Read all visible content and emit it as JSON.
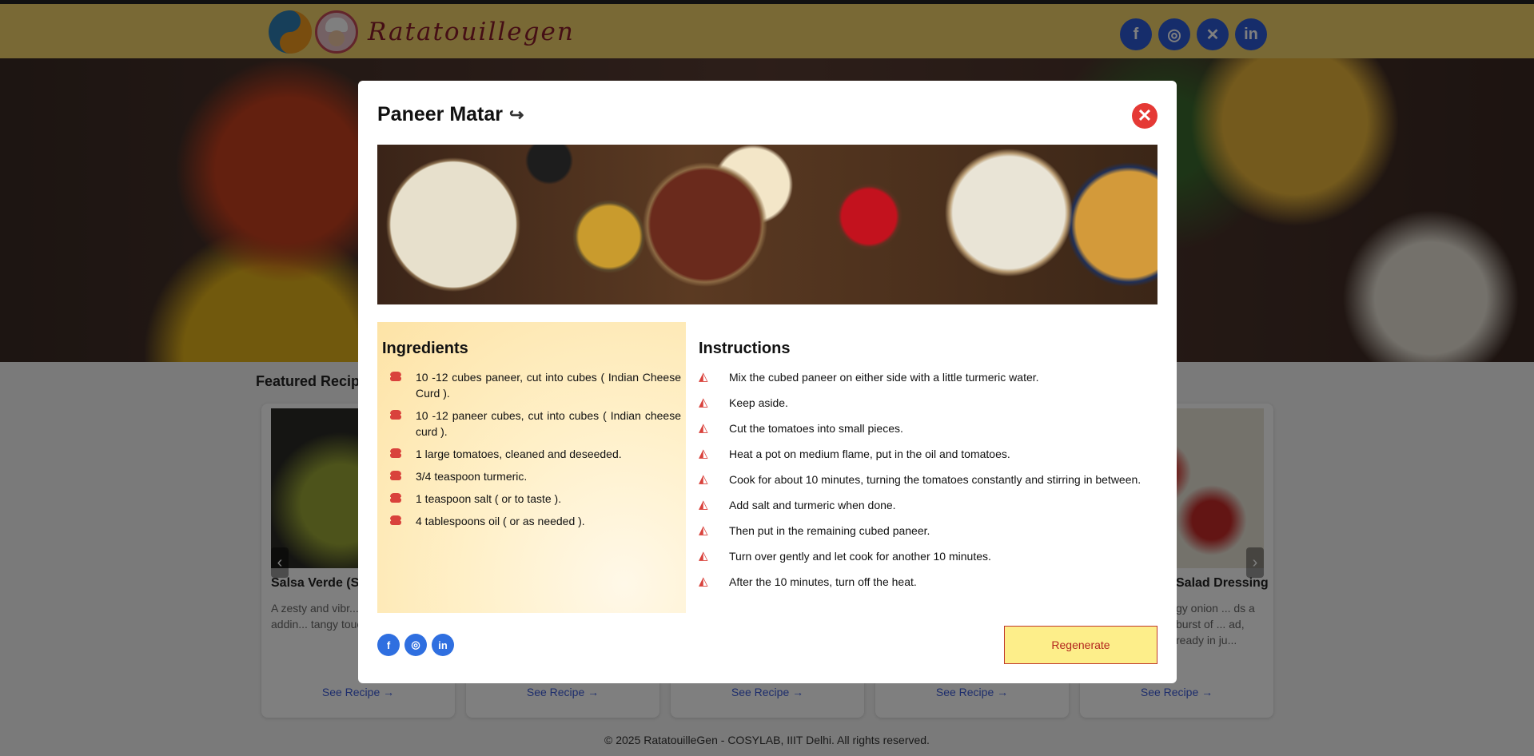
{
  "navbar": {
    "brand": "Ratatouillegen",
    "socials": [
      {
        "icon": "facebook-icon",
        "glyph": "f"
      },
      {
        "icon": "instagram-icon",
        "glyph": "◎"
      },
      {
        "icon": "x-icon",
        "glyph": "✕"
      },
      {
        "icon": "linkedin-icon",
        "glyph": "in"
      }
    ]
  },
  "featured": {
    "title": "Featured Recipes",
    "cards": [
      {
        "title": "Salsa Verde (S",
        "desc": "A zesty and vibr... perfect for addin... tangy touch to a...",
        "link": "See Recipe"
      },
      {
        "title": "",
        "desc": "",
        "link": "See Recipe"
      },
      {
        "title": "",
        "desc": "",
        "link": "See Recipe"
      },
      {
        "title": "",
        "desc": "",
        "link": "See Recipe"
      },
      {
        "title": "Salad Dressing",
        "desc": "gy onion ... ds a burst of ... ad, ready in ju...",
        "link": "See Recipe"
      }
    ]
  },
  "footer": "© 2025 RatatouilleGen - COSYLAB, IIIT Delhi. All rights reserved.",
  "modal": {
    "title": "Paneer Matar",
    "share_icon": "↪",
    "close_glyph": "✕",
    "ingredients_title": "Ingredients",
    "ingredients": [
      "10 -12 cubes paneer, cut into cubes ( Indian Cheese Curd ).",
      "10 -12 paneer cubes, cut into cubes ( Indian cheese curd ).",
      "1 large tomatoes, cleaned and deseeded.",
      "3/4 teaspoon turmeric.",
      "1 teaspoon salt ( or to taste ).",
      "4 tablespoons oil ( or as needed )."
    ],
    "instructions_title": "Instructions",
    "instructions": [
      "Mix the cubed paneer on either side with a little turmeric water.",
      "Keep aside.",
      "Cut the tomatoes into small pieces.",
      "Heat a pot on medium flame, put in the oil and tomatoes.",
      "Cook for about 10 minutes, turning the tomatoes constantly and stirring in between.",
      "Add salt and turmeric when done.",
      "Then put in the remaining cubed paneer.",
      "Turn over gently and let cook for another 10 minutes.",
      "After the 10 minutes, turn off the heat."
    ],
    "share_socials": [
      {
        "icon": "facebook-icon",
        "glyph": "f"
      },
      {
        "icon": "instagram-icon",
        "glyph": "◎"
      },
      {
        "icon": "linkedin-icon",
        "glyph": "in"
      }
    ],
    "regenerate_label": "Regenerate"
  },
  "colors": {
    "navbar": "#f3d36b",
    "brand_text": "#8b1c2a",
    "close_button": "#e53935",
    "regenerate_bg": "#fdee8a",
    "regenerate_border": "#c0392b",
    "list_icon": "#d9423c",
    "social_blue": "#2f6fe0"
  }
}
